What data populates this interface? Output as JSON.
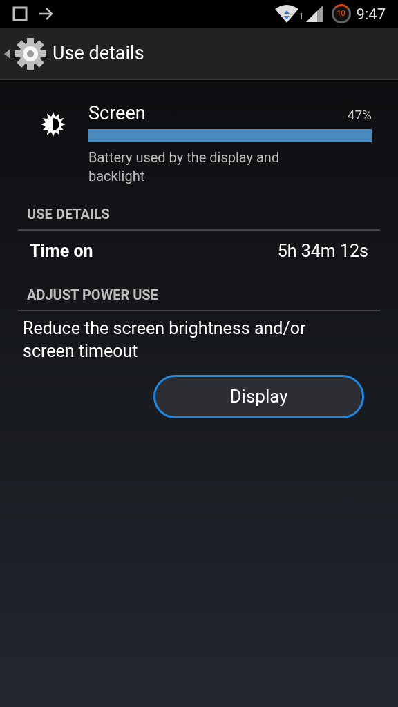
{
  "status_bar": {
    "wifi_sim": "1",
    "timer": "10",
    "time": "9:47"
  },
  "action_bar": {
    "title": "Use details"
  },
  "usage": {
    "name": "Screen",
    "percent": "47%",
    "level": 1,
    "description": "Battery used by the display and backlight"
  },
  "sections": [
    {
      "kind": "details",
      "header": "USE DETAILS",
      "label": "Time on",
      "value": "5h 34m 12s"
    },
    {
      "kind": "action",
      "header": "ADJUST POWER USE",
      "description": "Reduce the screen brightness and/or screen timeout",
      "button": "Display"
    }
  ]
}
